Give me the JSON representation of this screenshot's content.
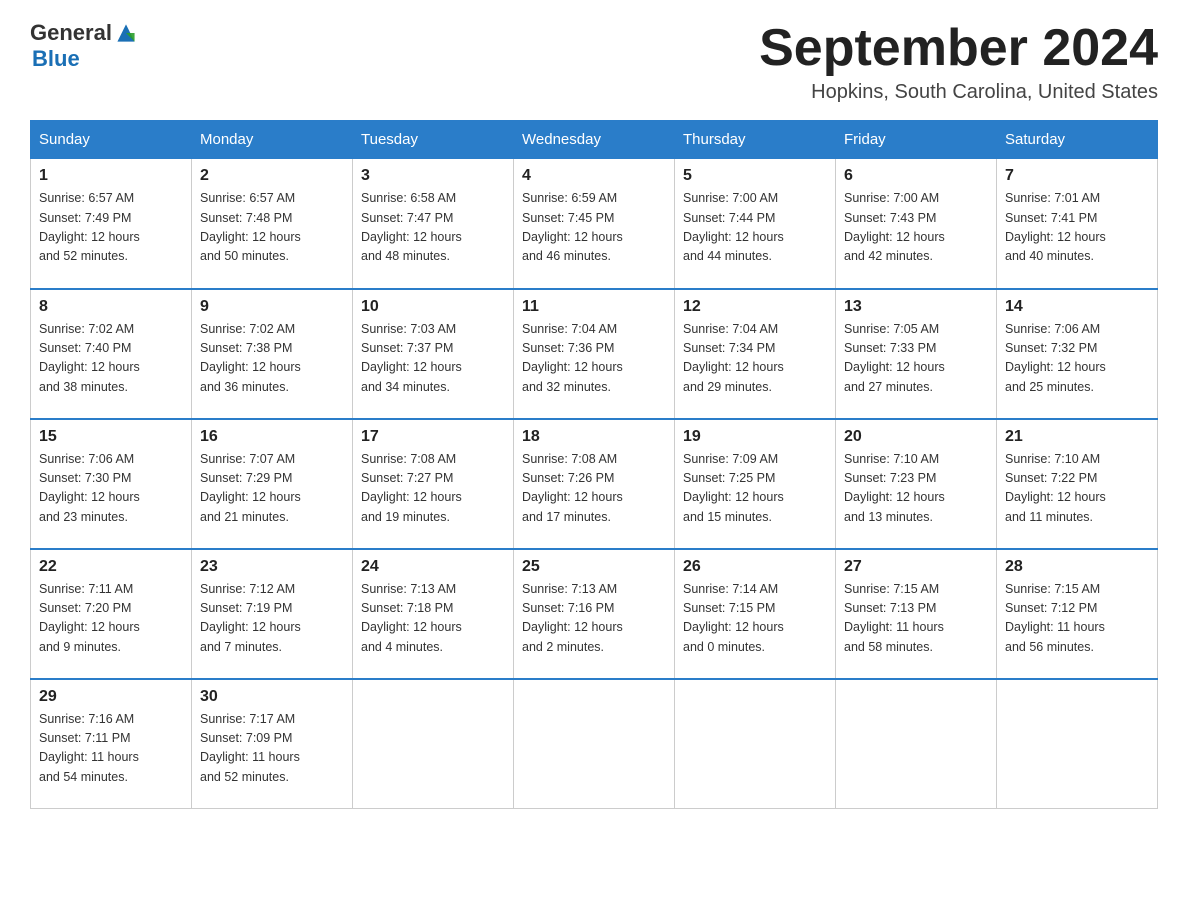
{
  "header": {
    "logo_general": "General",
    "logo_blue": "Blue",
    "month_title": "September 2024",
    "location": "Hopkins, South Carolina, United States"
  },
  "weekdays": [
    "Sunday",
    "Monday",
    "Tuesday",
    "Wednesday",
    "Thursday",
    "Friday",
    "Saturday"
  ],
  "weeks": [
    [
      {
        "day": "1",
        "info": "Sunrise: 6:57 AM\nSunset: 7:49 PM\nDaylight: 12 hours\nand 52 minutes."
      },
      {
        "day": "2",
        "info": "Sunrise: 6:57 AM\nSunset: 7:48 PM\nDaylight: 12 hours\nand 50 minutes."
      },
      {
        "day": "3",
        "info": "Sunrise: 6:58 AM\nSunset: 7:47 PM\nDaylight: 12 hours\nand 48 minutes."
      },
      {
        "day": "4",
        "info": "Sunrise: 6:59 AM\nSunset: 7:45 PM\nDaylight: 12 hours\nand 46 minutes."
      },
      {
        "day": "5",
        "info": "Sunrise: 7:00 AM\nSunset: 7:44 PM\nDaylight: 12 hours\nand 44 minutes."
      },
      {
        "day": "6",
        "info": "Sunrise: 7:00 AM\nSunset: 7:43 PM\nDaylight: 12 hours\nand 42 minutes."
      },
      {
        "day": "7",
        "info": "Sunrise: 7:01 AM\nSunset: 7:41 PM\nDaylight: 12 hours\nand 40 minutes."
      }
    ],
    [
      {
        "day": "8",
        "info": "Sunrise: 7:02 AM\nSunset: 7:40 PM\nDaylight: 12 hours\nand 38 minutes."
      },
      {
        "day": "9",
        "info": "Sunrise: 7:02 AM\nSunset: 7:38 PM\nDaylight: 12 hours\nand 36 minutes."
      },
      {
        "day": "10",
        "info": "Sunrise: 7:03 AM\nSunset: 7:37 PM\nDaylight: 12 hours\nand 34 minutes."
      },
      {
        "day": "11",
        "info": "Sunrise: 7:04 AM\nSunset: 7:36 PM\nDaylight: 12 hours\nand 32 minutes."
      },
      {
        "day": "12",
        "info": "Sunrise: 7:04 AM\nSunset: 7:34 PM\nDaylight: 12 hours\nand 29 minutes."
      },
      {
        "day": "13",
        "info": "Sunrise: 7:05 AM\nSunset: 7:33 PM\nDaylight: 12 hours\nand 27 minutes."
      },
      {
        "day": "14",
        "info": "Sunrise: 7:06 AM\nSunset: 7:32 PM\nDaylight: 12 hours\nand 25 minutes."
      }
    ],
    [
      {
        "day": "15",
        "info": "Sunrise: 7:06 AM\nSunset: 7:30 PM\nDaylight: 12 hours\nand 23 minutes."
      },
      {
        "day": "16",
        "info": "Sunrise: 7:07 AM\nSunset: 7:29 PM\nDaylight: 12 hours\nand 21 minutes."
      },
      {
        "day": "17",
        "info": "Sunrise: 7:08 AM\nSunset: 7:27 PM\nDaylight: 12 hours\nand 19 minutes."
      },
      {
        "day": "18",
        "info": "Sunrise: 7:08 AM\nSunset: 7:26 PM\nDaylight: 12 hours\nand 17 minutes."
      },
      {
        "day": "19",
        "info": "Sunrise: 7:09 AM\nSunset: 7:25 PM\nDaylight: 12 hours\nand 15 minutes."
      },
      {
        "day": "20",
        "info": "Sunrise: 7:10 AM\nSunset: 7:23 PM\nDaylight: 12 hours\nand 13 minutes."
      },
      {
        "day": "21",
        "info": "Sunrise: 7:10 AM\nSunset: 7:22 PM\nDaylight: 12 hours\nand 11 minutes."
      }
    ],
    [
      {
        "day": "22",
        "info": "Sunrise: 7:11 AM\nSunset: 7:20 PM\nDaylight: 12 hours\nand 9 minutes."
      },
      {
        "day": "23",
        "info": "Sunrise: 7:12 AM\nSunset: 7:19 PM\nDaylight: 12 hours\nand 7 minutes."
      },
      {
        "day": "24",
        "info": "Sunrise: 7:13 AM\nSunset: 7:18 PM\nDaylight: 12 hours\nand 4 minutes."
      },
      {
        "day": "25",
        "info": "Sunrise: 7:13 AM\nSunset: 7:16 PM\nDaylight: 12 hours\nand 2 minutes."
      },
      {
        "day": "26",
        "info": "Sunrise: 7:14 AM\nSunset: 7:15 PM\nDaylight: 12 hours\nand 0 minutes."
      },
      {
        "day": "27",
        "info": "Sunrise: 7:15 AM\nSunset: 7:13 PM\nDaylight: 11 hours\nand 58 minutes."
      },
      {
        "day": "28",
        "info": "Sunrise: 7:15 AM\nSunset: 7:12 PM\nDaylight: 11 hours\nand 56 minutes."
      }
    ],
    [
      {
        "day": "29",
        "info": "Sunrise: 7:16 AM\nSunset: 7:11 PM\nDaylight: 11 hours\nand 54 minutes."
      },
      {
        "day": "30",
        "info": "Sunrise: 7:17 AM\nSunset: 7:09 PM\nDaylight: 11 hours\nand 52 minutes."
      },
      {
        "day": "",
        "info": ""
      },
      {
        "day": "",
        "info": ""
      },
      {
        "day": "",
        "info": ""
      },
      {
        "day": "",
        "info": ""
      },
      {
        "day": "",
        "info": ""
      }
    ]
  ]
}
